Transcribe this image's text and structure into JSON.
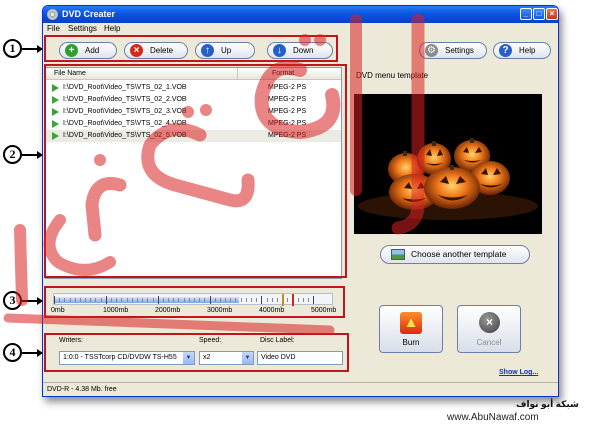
{
  "window": {
    "title": "DVD Creater",
    "minimize": "_",
    "maximize": "□",
    "close": "×"
  },
  "menu": [
    "File",
    "Settings",
    "Help"
  ],
  "toolbar": {
    "add_label": "Add",
    "delete_label": "Delete",
    "up_label": "Up",
    "down_label": "Down",
    "settings_label": "Settings",
    "help_label": "Help"
  },
  "file_list": {
    "columns": [
      "File Name",
      "Format"
    ],
    "rows": [
      {
        "name": "I:\\DVD_Root\\Video_TS\\VTS_02_1.VOB",
        "format": "MPEG-2 PS"
      },
      {
        "name": "I:\\DVD_Root\\Video_TS\\VTS_02_2.VOB",
        "format": "MPEG-2 PS"
      },
      {
        "name": "I:\\DVD_Root\\Video_TS\\VTS_02_3.VOB",
        "format": "MPEG-2 PS"
      },
      {
        "name": "I:\\DVD_Root\\Video_TS\\VTS_02_4.VOB",
        "format": "MPEG-2 PS"
      },
      {
        "name": "I:\\DVD_Root\\Video_TS\\VTS_02_5.VOB",
        "format": "MPEG-2 PS"
      }
    ],
    "selected_index": 4
  },
  "template": {
    "label": "DVD menu template",
    "choose_label": "Choose another template"
  },
  "size_bar": {
    "labels": [
      "0mb",
      "1000mb",
      "2000mb",
      "3000mb",
      "4000mb",
      "5000mb"
    ],
    "used_fraction": 0.74
  },
  "writer_settings": {
    "writers_label": "Writers:",
    "writer_value": "1:0:0 - TSSTcorp CD/DVDW TS-H55",
    "speed_label": "Speed:",
    "speed_value": "x2",
    "disc_label": "Disc Label:",
    "disc_value": "Video DVD"
  },
  "actions": {
    "burn_label": "Burn",
    "cancel_label": "Cancel",
    "show_log_label": "Show Log..."
  },
  "status": "DVD-R - 4.38 Mb. free",
  "callouts": [
    "1",
    "2",
    "3",
    "4"
  ],
  "watermark": {
    "arabic": "شبكة أبو نواف",
    "url": "www.AbuNawaf.com"
  },
  "colors": {
    "title_bar": "#0a55e1",
    "highlight": "#c0151b",
    "accent_green": "#3aa33d"
  }
}
